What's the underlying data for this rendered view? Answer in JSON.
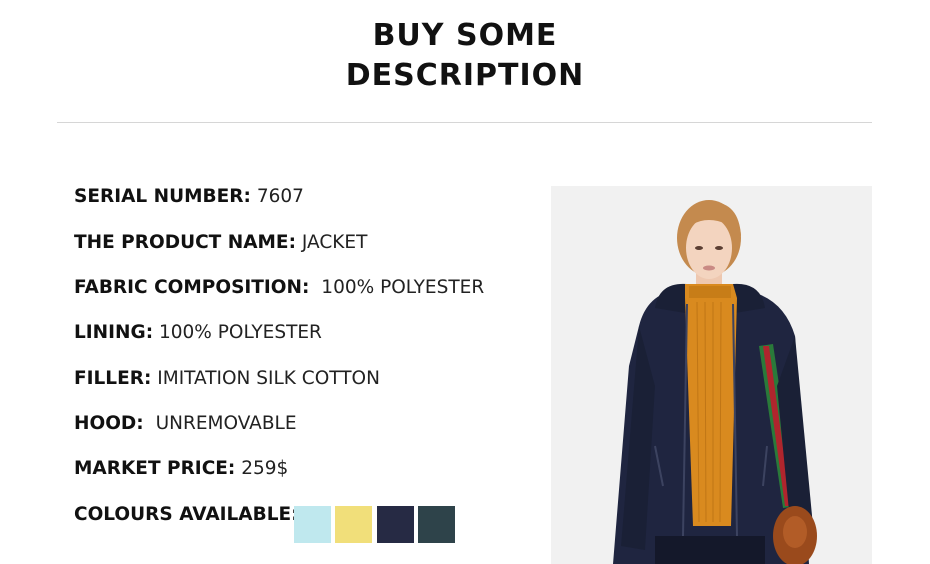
{
  "header": {
    "title_line1": "BUY SOME",
    "title_line2": "DESCRIPTION"
  },
  "details": [
    {
      "label": "SERIAL NUMBER:",
      "value": "7607"
    },
    {
      "label": "THE PRODUCT NAME:",
      "value": "JACKET"
    },
    {
      "label": "FABRIC COMPOSITION:",
      "value": "100% POLYESTER"
    },
    {
      "label": "LINING:",
      "value": "100% POLYESTER"
    },
    {
      "label": "FILLER:",
      "value": "IMITATION SILK COTTON"
    },
    {
      "label": "HOOD:",
      "value": "UNREMOVABLE"
    },
    {
      "label": "MARKET PRICE:",
      "value": "259$"
    },
    {
      "label": "COLOURS AVAILABLE:",
      "value": ""
    }
  ],
  "colours": [
    "#bfe8ee",
    "#f1df7a",
    "#262a44",
    "#2e434a"
  ],
  "photo": {
    "background": "#f1f1f1",
    "jacket_color": "#1f2540",
    "sweater_color": "#d98a1f",
    "hair_color": "#c48a4e",
    "bag_color": "#9a4a1c"
  }
}
